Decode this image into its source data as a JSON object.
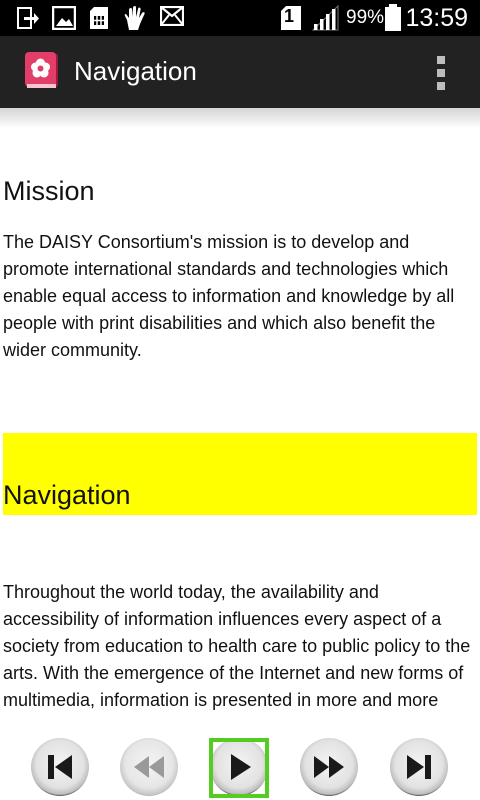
{
  "status_bar": {
    "icons": [
      "download-icon",
      "image-icon",
      "sim-card-icon",
      "hand-icon",
      "mail-icon",
      "sim-1-icon",
      "signal-icon",
      "battery-icon"
    ],
    "sim_label": "1",
    "battery_percent": "99%",
    "time": "13:59"
  },
  "app_bar": {
    "icon": "daisy-flower-book-icon",
    "title": "Navigation",
    "menu_icon": "more-vert-icon"
  },
  "content": {
    "sections": [
      {
        "heading": "Mission",
        "text": "The DAISY Consortium's mission is to develop and promote international standards and technologies which enable equal access to information and knowledge by all people with print disabilities and which also benefit the wider community."
      },
      {
        "heading": "Navigation",
        "highlighted": true,
        "highlight_color": "#ffff00",
        "text": "Throughout the world today, the availability and accessibility of information influences every aspect of a society from education to health care to public policy to the arts. With the emergence of the Internet and new forms of multimedia, information is presented in more and more"
      }
    ]
  },
  "controls": {
    "buttons": [
      "skip-previous-icon",
      "rewind-icon",
      "play-icon",
      "fast-forward-icon",
      "skip-next-icon"
    ],
    "focused": "play-icon",
    "focus_color": "#55cc22"
  }
}
